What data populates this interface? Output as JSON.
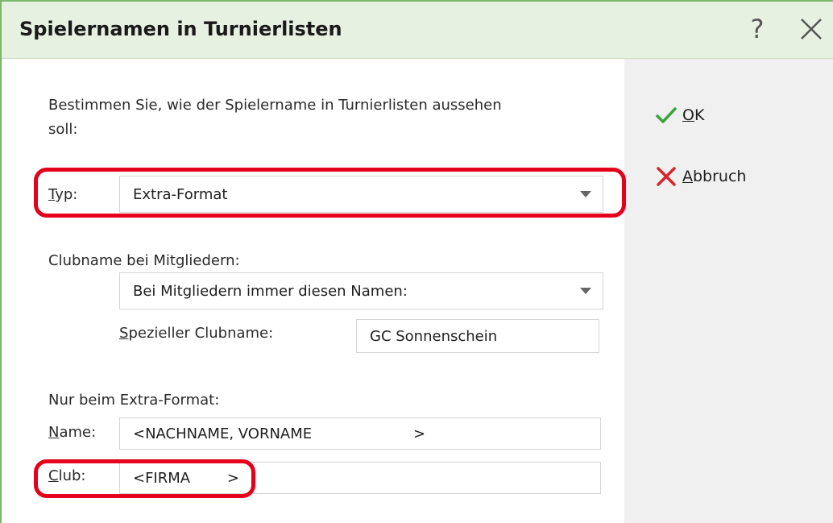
{
  "window": {
    "title": "Spielernamen in Turnierlisten",
    "help_glyph": "?",
    "close_icon": "close-icon"
  },
  "actions": {
    "ok_mnemonic": "O",
    "ok_rest": "K",
    "cancel_mnemonic": "A",
    "cancel_rest": "bbruch",
    "ok_color": "#3da33a",
    "cancel_color": "#d8232a"
  },
  "form": {
    "description": "Bestimmen Sie, wie der Spielername in Turnierlisten aussehen soll:",
    "typ_label_mnemonic": "T",
    "typ_label_rest": "yp:",
    "typ_value": "Extra-Format",
    "clubname_label": "Clubname bei Mitgliedern:",
    "clubname_mode_value": "Bei Mitgliedern immer diesen Namen:",
    "spezieller_label_mnemonic": "S",
    "spezieller_label_rest": "pezieller Clubname:",
    "spezieller_value": "GC Sonnenschein",
    "extra_section_label": "Nur beim Extra-Format:",
    "name_label_mnemonic": "N",
    "name_label_rest": "ame:",
    "name_value": "<NACHNAME, VORNAME                      >",
    "club_label_mnemonic": "C",
    "club_label_rest": "lub:",
    "club_value": "<FIRMA        >"
  },
  "annotations": {
    "highlight_color": "#e4001b"
  }
}
